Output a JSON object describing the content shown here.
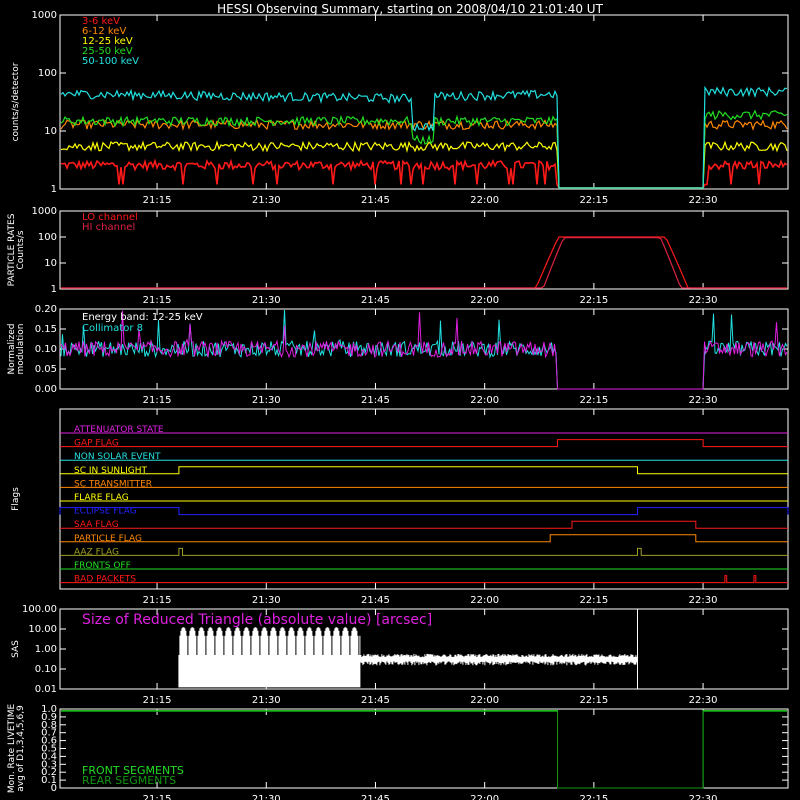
{
  "title": "HESSI Observing Summary, starting on 2008/04/10 21:01:40 UT",
  "colors": {
    "background": "#000000",
    "axes": "#ffffff",
    "red": "#ff1a1a",
    "orange": "#ff8800",
    "yellow": "#ffff00",
    "green": "#22dd22",
    "cyan": "#22e0e0",
    "magenta": "#e020e0",
    "blue": "#2222ff",
    "olive": "#a0a020",
    "darkgreen": "#129612",
    "crimson": "#dd2244"
  },
  "time_axis": {
    "x_start": "21:01:40",
    "x_end": "22:41:40",
    "tick_labels": [
      "21:15",
      "21:30",
      "21:45",
      "22:00",
      "22:15",
      "22:30"
    ],
    "tick_minutes": [
      73.33,
      88.33,
      103.33,
      118.33,
      133.33,
      148.33
    ]
  },
  "chart_data": [
    {
      "type": "line",
      "name": "count-rates",
      "ylabel": "counts/s/detector",
      "yscale": "log",
      "ylim": [
        1,
        1000
      ],
      "ytick_labels": [
        "1",
        "10",
        "100",
        "1000"
      ],
      "legend": [
        "3-6 keV",
        "6-12 keV",
        "12-25 keV",
        "25-50 keV",
        "50-100 keV"
      ],
      "legend_placement": "top-left",
      "data_gap": [
        "22:10",
        "22:30"
      ],
      "series": [
        {
          "name": "3-6 keV",
          "color": "red",
          "level": 2.6,
          "dropouts": true
        },
        {
          "name": "6-12 keV",
          "color": "orange",
          "level": 13
        },
        {
          "name": "12-25 keV",
          "color": "yellow",
          "level": 5.5
        },
        {
          "name": "25-50 keV",
          "color": "green",
          "level": 15
        },
        {
          "name": "50-100 keV",
          "color": "cyan",
          "level": 42
        }
      ]
    },
    {
      "type": "line",
      "name": "particle-rates",
      "ylabel": [
        "PARTICLE RATES",
        "Counts/s"
      ],
      "yscale": "log",
      "ylim": [
        1,
        1000
      ],
      "ytick_labels": [
        "1",
        "10",
        "100",
        "1000"
      ],
      "legend": [
        "LO channel",
        "HI channel"
      ],
      "legend_placement": "top-left",
      "series": [
        {
          "name": "LO channel",
          "color": "red",
          "baseline": 1,
          "peak": 100,
          "start": "22:07",
          "end": "22:28"
        },
        {
          "name": "HI channel",
          "color": "crimson",
          "baseline": 1,
          "peak": 95,
          "start": "22:08",
          "end": "22:27"
        }
      ]
    },
    {
      "type": "line",
      "name": "modulation",
      "ylabel": [
        "Normalized",
        "modulation"
      ],
      "ylim": [
        0,
        0.2
      ],
      "ytick_labels": [
        "0.00",
        "0.05",
        "0.10",
        "0.15",
        "0.20"
      ],
      "annotations": [
        "Energy band: 12-25 keV",
        "Collimator 8"
      ],
      "series": [
        {
          "name": "modulation",
          "color": "cyan",
          "level": 0.1
        },
        {
          "name": "modulation",
          "color": "magenta",
          "level": 0.1
        }
      ]
    },
    {
      "type": "table",
      "name": "flags",
      "ylabel": "Flags",
      "rows": [
        {
          "label": "ATTENUATOR STATE",
          "color": "magenta",
          "high": []
        },
        {
          "label": "GAP FLAG",
          "color": "red",
          "high": [
            [
              "22:10",
              "22:30"
            ]
          ]
        },
        {
          "label": "NON SOLAR EVENT",
          "color": "cyan",
          "high": []
        },
        {
          "label": "SC IN SUNLIGHT",
          "color": "yellow",
          "high": [
            [
              "21:18",
              "22:21"
            ]
          ]
        },
        {
          "label": "SC TRANSMITTER",
          "color": "orange",
          "high": []
        },
        {
          "label": "FLARE FLAG",
          "color": "yellow",
          "high": []
        },
        {
          "label": "ECLIPSE FLAG",
          "color": "blue",
          "high": [
            [
              "21:01:40",
              "21:18"
            ],
            [
              "22:21",
              "22:41:40"
            ]
          ]
        },
        {
          "label": "SAA FLAG",
          "color": "red",
          "high": [
            [
              "22:12",
              "22:29"
            ]
          ]
        },
        {
          "label": "PARTICLE FLAG",
          "color": "orange",
          "high": [
            [
              "22:09",
              "22:29"
            ]
          ]
        },
        {
          "label": "AAZ FLAG",
          "color": "olive",
          "high": [
            [
              "21:18",
              "21:18:30"
            ],
            [
              "22:21",
              "22:21:30"
            ]
          ]
        },
        {
          "label": "FRONTS OFF",
          "color": "green",
          "high": []
        },
        {
          "label": "BAD PACKETS",
          "color": "red",
          "high": [
            [
              "22:33",
              "22:33:15"
            ],
            [
              "22:37",
              "22:37:15"
            ]
          ]
        }
      ]
    },
    {
      "type": "line",
      "name": "sas",
      "ylabel": "SAS",
      "yscale": "log",
      "ylim": [
        0.01,
        100
      ],
      "ytick_labels": [
        "0.01",
        "0.10",
        "1.00",
        "10.00",
        "100.00"
      ],
      "annotation": "Size of Reduced Triangle (absolute value) [arcsec]",
      "series": [
        {
          "name": "Size of Reduced Triangle",
          "color": "white",
          "start": "21:18",
          "end": "22:21",
          "settled_level": 0.3
        }
      ]
    },
    {
      "type": "line",
      "name": "livetime",
      "ylabel": [
        "Mon. Rate LIVETIME",
        "avg of D1,3,4,5,6,9"
      ],
      "ylim": [
        0,
        1.0
      ],
      "ytick_labels": [
        "0",
        "0.1",
        "0.2",
        "0.3",
        "0.4",
        "0.5",
        "0.6",
        "0.7",
        "0.8",
        "0.9",
        "1.0"
      ],
      "legend": [
        "FRONT SEGMENTS",
        "REAR SEGMENTS"
      ],
      "legend_placement": "bottom-left",
      "data_gap": [
        "22:10",
        "22:30"
      ],
      "series": [
        {
          "name": "FRONT SEGMENTS",
          "color": "green",
          "level": 0.98
        },
        {
          "name": "REAR SEGMENTS",
          "color": "darkgreen",
          "level": 0.97
        }
      ]
    }
  ]
}
